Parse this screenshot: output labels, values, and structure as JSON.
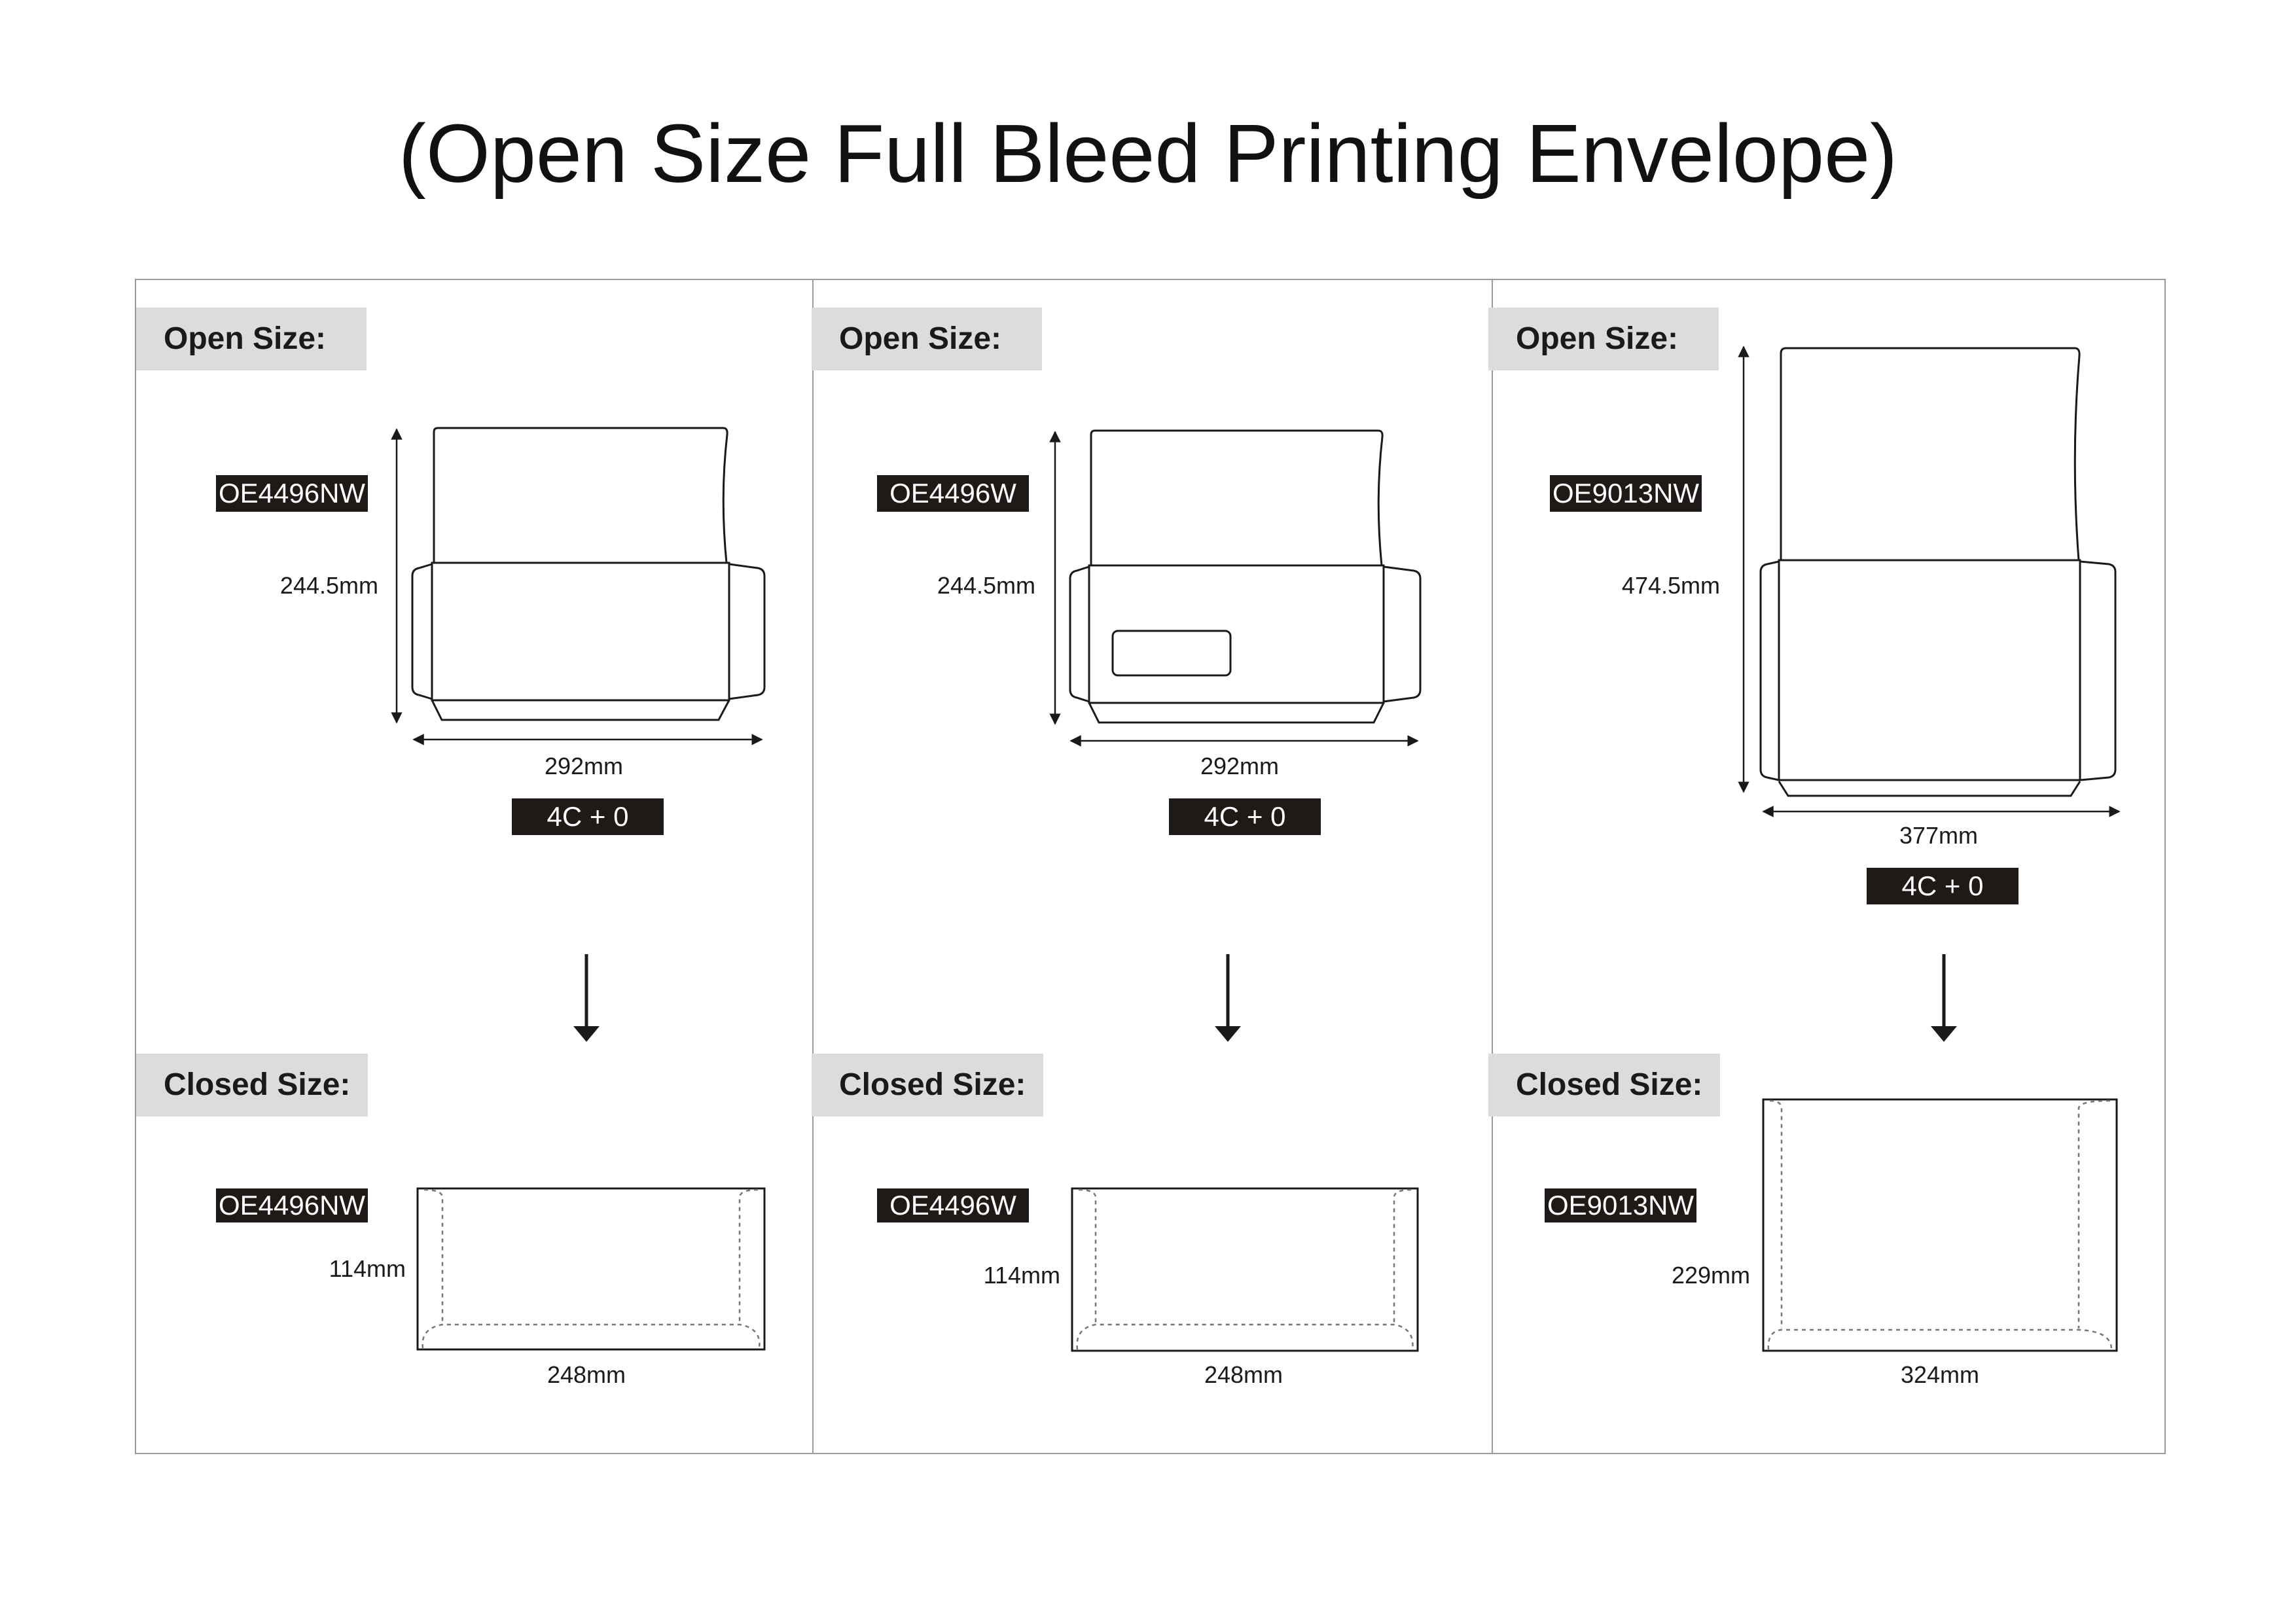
{
  "title": "(Open Size Full Bleed Printing Envelope)",
  "open_label": "Open Size:",
  "closed_label": "Closed Size:",
  "columns": [
    {
      "open_code": "OE4496NW",
      "open_height": "244.5mm",
      "open_width": "292mm",
      "print_spec": "4C + 0",
      "closed_code": "OE4496NW",
      "closed_height": "114mm",
      "closed_width": "248mm"
    },
    {
      "open_code": "OE4496W",
      "open_height": "244.5mm",
      "open_width": "292mm",
      "print_spec": "4C + 0",
      "closed_code": "OE4496W",
      "closed_height": "114mm",
      "closed_width": "248mm"
    },
    {
      "open_code": "OE9013NW",
      "open_height": "474.5mm",
      "open_width": "377mm",
      "print_spec": "4C + 0",
      "closed_code": "OE9013NW",
      "closed_height": "229mm",
      "closed_width": "324mm"
    }
  ]
}
